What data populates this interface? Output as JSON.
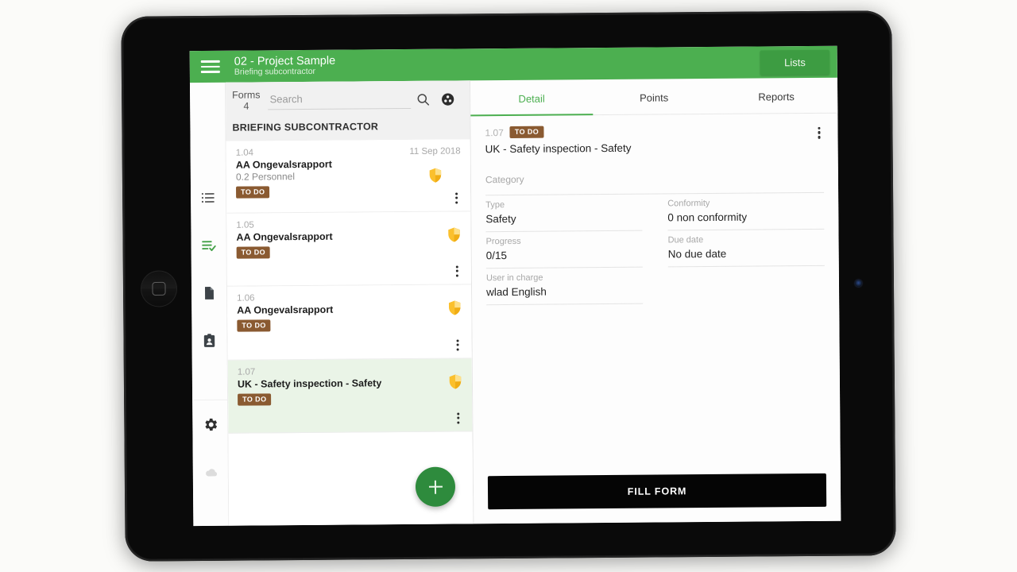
{
  "appbar": {
    "menu_icon": "hamburger-menu-icon",
    "title": "02 - Project Sample",
    "subtitle": "Briefing subcontractor",
    "lists_button": "Lists"
  },
  "rail": {
    "items": [
      {
        "icon": "list-icon",
        "name": "rail-item-lists",
        "active": false
      },
      {
        "icon": "checklist-icon",
        "name": "rail-item-forms",
        "active": true
      },
      {
        "icon": "document-icon",
        "name": "rail-item-documents",
        "active": false
      },
      {
        "icon": "contact-card-icon",
        "name": "rail-item-contacts",
        "active": false
      },
      {
        "icon": "gear-icon",
        "name": "rail-item-settings",
        "active": false
      },
      {
        "icon": "cloud-icon",
        "name": "rail-item-sync",
        "active": false
      }
    ]
  },
  "list_pane": {
    "forms_label": "Forms",
    "forms_count": "4",
    "search_placeholder": "Search",
    "search_value": "",
    "search_icon": "search-icon",
    "group_icon": "group-filter-icon",
    "section_title": "BRIEFING SUBCONTRACTOR",
    "add_button_icon": "plus-icon",
    "items": [
      {
        "code": "1.04",
        "title": "AA Ongevalsrapport",
        "subtitle": "0.2 Personnel",
        "date": "11 Sep 2018",
        "status": "TO DO",
        "shield": "safety-shield-icon",
        "selected": false
      },
      {
        "code": "1.05",
        "title": "AA Ongevalsrapport",
        "subtitle": "",
        "date": "",
        "status": "TO DO",
        "shield": "safety-shield-icon",
        "selected": false
      },
      {
        "code": "1.06",
        "title": "AA Ongevalsrapport",
        "subtitle": "",
        "date": "",
        "status": "TO DO",
        "shield": "safety-shield-icon",
        "selected": false
      },
      {
        "code": "1.07",
        "title": "UK - Safety inspection - Safety",
        "subtitle": "",
        "date": "",
        "status": "TO DO",
        "shield": "safety-shield-icon",
        "selected": true
      }
    ]
  },
  "detail": {
    "tabs": [
      {
        "label": "Detail",
        "active": true
      },
      {
        "label": "Points",
        "active": false
      },
      {
        "label": "Reports",
        "active": false
      }
    ],
    "header": {
      "code": "1.07",
      "status": "TO DO",
      "title": "UK - Safety inspection - Safety",
      "menu_icon": "kebab-menu-icon"
    },
    "fields": {
      "category_label": "Category",
      "type_label": "Type",
      "type_value": "Safety",
      "conformity_label": "Conformity",
      "conformity_value": "0 non conformity",
      "progress_label": "Progress",
      "progress_value": "0/15",
      "due_date_label": "Due date",
      "due_date_value": "No due date",
      "user_label": "User in charge",
      "user_value": "wlad English"
    },
    "fill_form_button": "FILL FORM"
  },
  "colors": {
    "brand_green": "#4caf50",
    "accent_green": "#2e8b3d",
    "status_badge": "#8a5a31",
    "shield_yellow": "#fbc02d",
    "selected_row": "#eaf4e7"
  }
}
